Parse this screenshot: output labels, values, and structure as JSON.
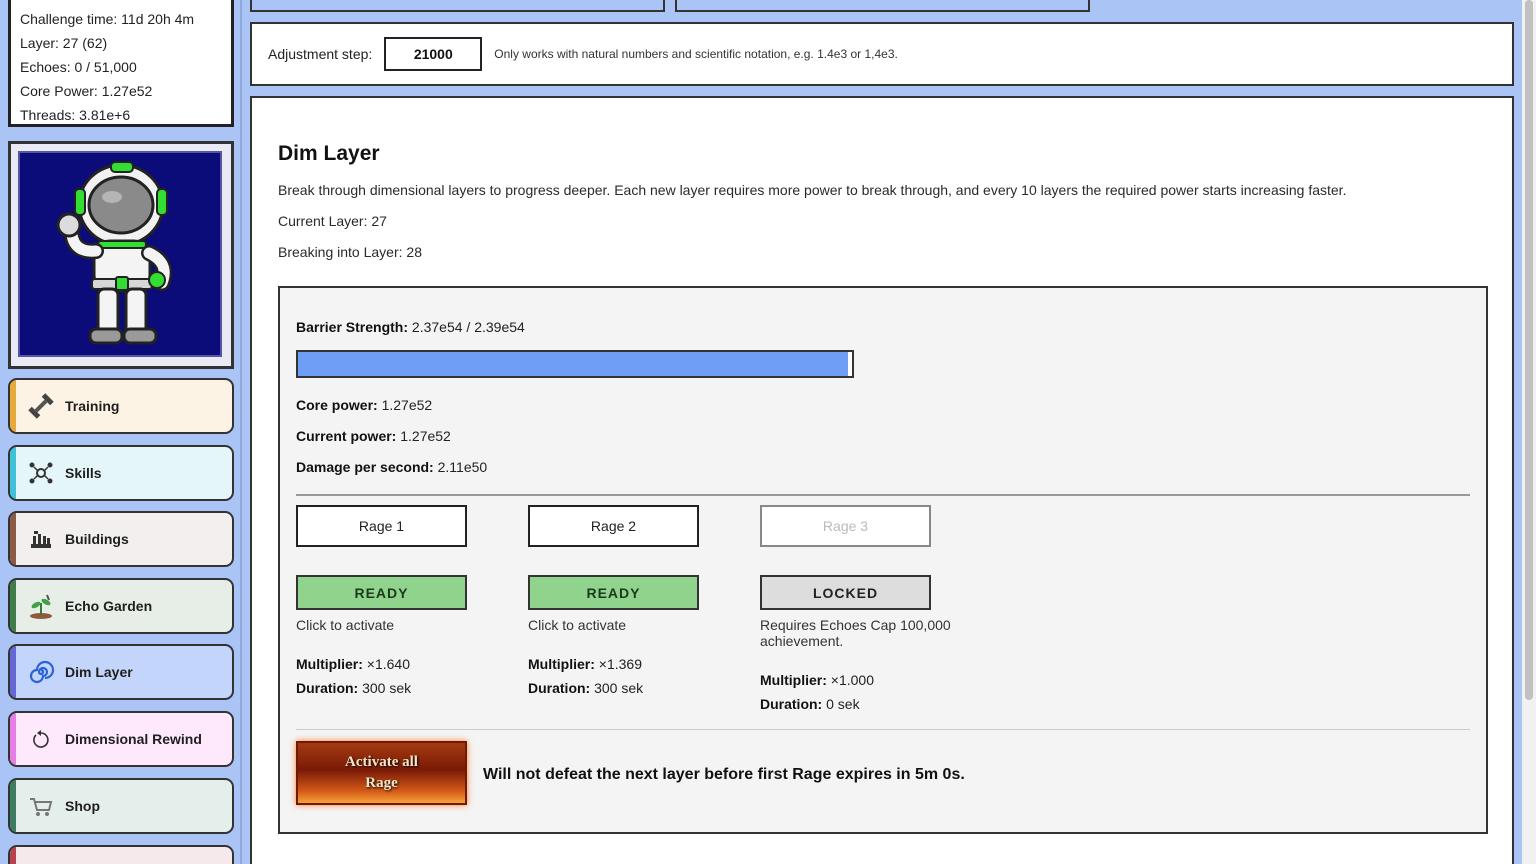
{
  "stats": {
    "challenge_time": "Challenge time: 11d 20h 4m",
    "layer": "Layer: 27 (62)",
    "echoes": "Echoes: 0 / 51,000",
    "core_power": "Core Power: 1.27e52",
    "threads": "Threads: 3.81e+6"
  },
  "sidebar": {
    "items": [
      {
        "label": "Training",
        "icon": "dumbbell-icon"
      },
      {
        "label": "Skills",
        "icon": "skill-tree-icon"
      },
      {
        "label": "Buildings",
        "icon": "buildings-icon"
      },
      {
        "label": "Echo Garden",
        "icon": "sprout-icon"
      },
      {
        "label": "Dim Layer",
        "icon": "spiral-icon"
      },
      {
        "label": "Dimensional Rewind",
        "icon": "rewind-icon"
      },
      {
        "label": "Shop",
        "icon": "cart-icon"
      }
    ],
    "active": "Dim Layer"
  },
  "adjustment": {
    "label": "Adjustment step:",
    "value": "21000",
    "hint": "Only works with natural numbers and scientific notation, e.g. 1.4e3 or 1,4e3."
  },
  "dim_layer": {
    "title": "Dim Layer",
    "description": "Break through dimensional layers to progress deeper. Each new layer requires more power to break through, and every 10 layers the required power starts increasing faster.",
    "current_layer": "Current Layer: 27",
    "breaking_into": "Breaking into Layer: 28",
    "barrier_label": "Barrier Strength:",
    "barrier_value": "2.37e54 / 2.39e54",
    "barrier_fraction": 0.992,
    "core_power_label": "Core power:",
    "core_power_value": "1.27e52",
    "current_power_label": "Current power:",
    "current_power_value": "1.27e52",
    "dps_label": "Damage per second:",
    "dps_value": "2.11e50"
  },
  "rage": [
    {
      "name": "Rage 1",
      "status": "READY",
      "note": "Click to activate",
      "multiplier_label": "Multiplier:",
      "multiplier": "×1.640",
      "duration_label": "Duration:",
      "duration": "300 sek"
    },
    {
      "name": "Rage 2",
      "status": "READY",
      "note": "Click to activate",
      "multiplier_label": "Multiplier:",
      "multiplier": "×1.369",
      "duration_label": "Duration:",
      "duration": "300 sek"
    },
    {
      "name": "Rage 3",
      "status": "LOCKED",
      "note": "Requires Echoes Cap 100,000 achievement.",
      "multiplier_label": "Multiplier:",
      "multiplier": "×1.000",
      "duration_label": "Duration:",
      "duration": "0 sek"
    }
  ],
  "activate_all": {
    "line1": "Activate all",
    "line2": "Rage"
  },
  "warning": "Will not defeat the next layer before first Rage expires in 5m 0s."
}
